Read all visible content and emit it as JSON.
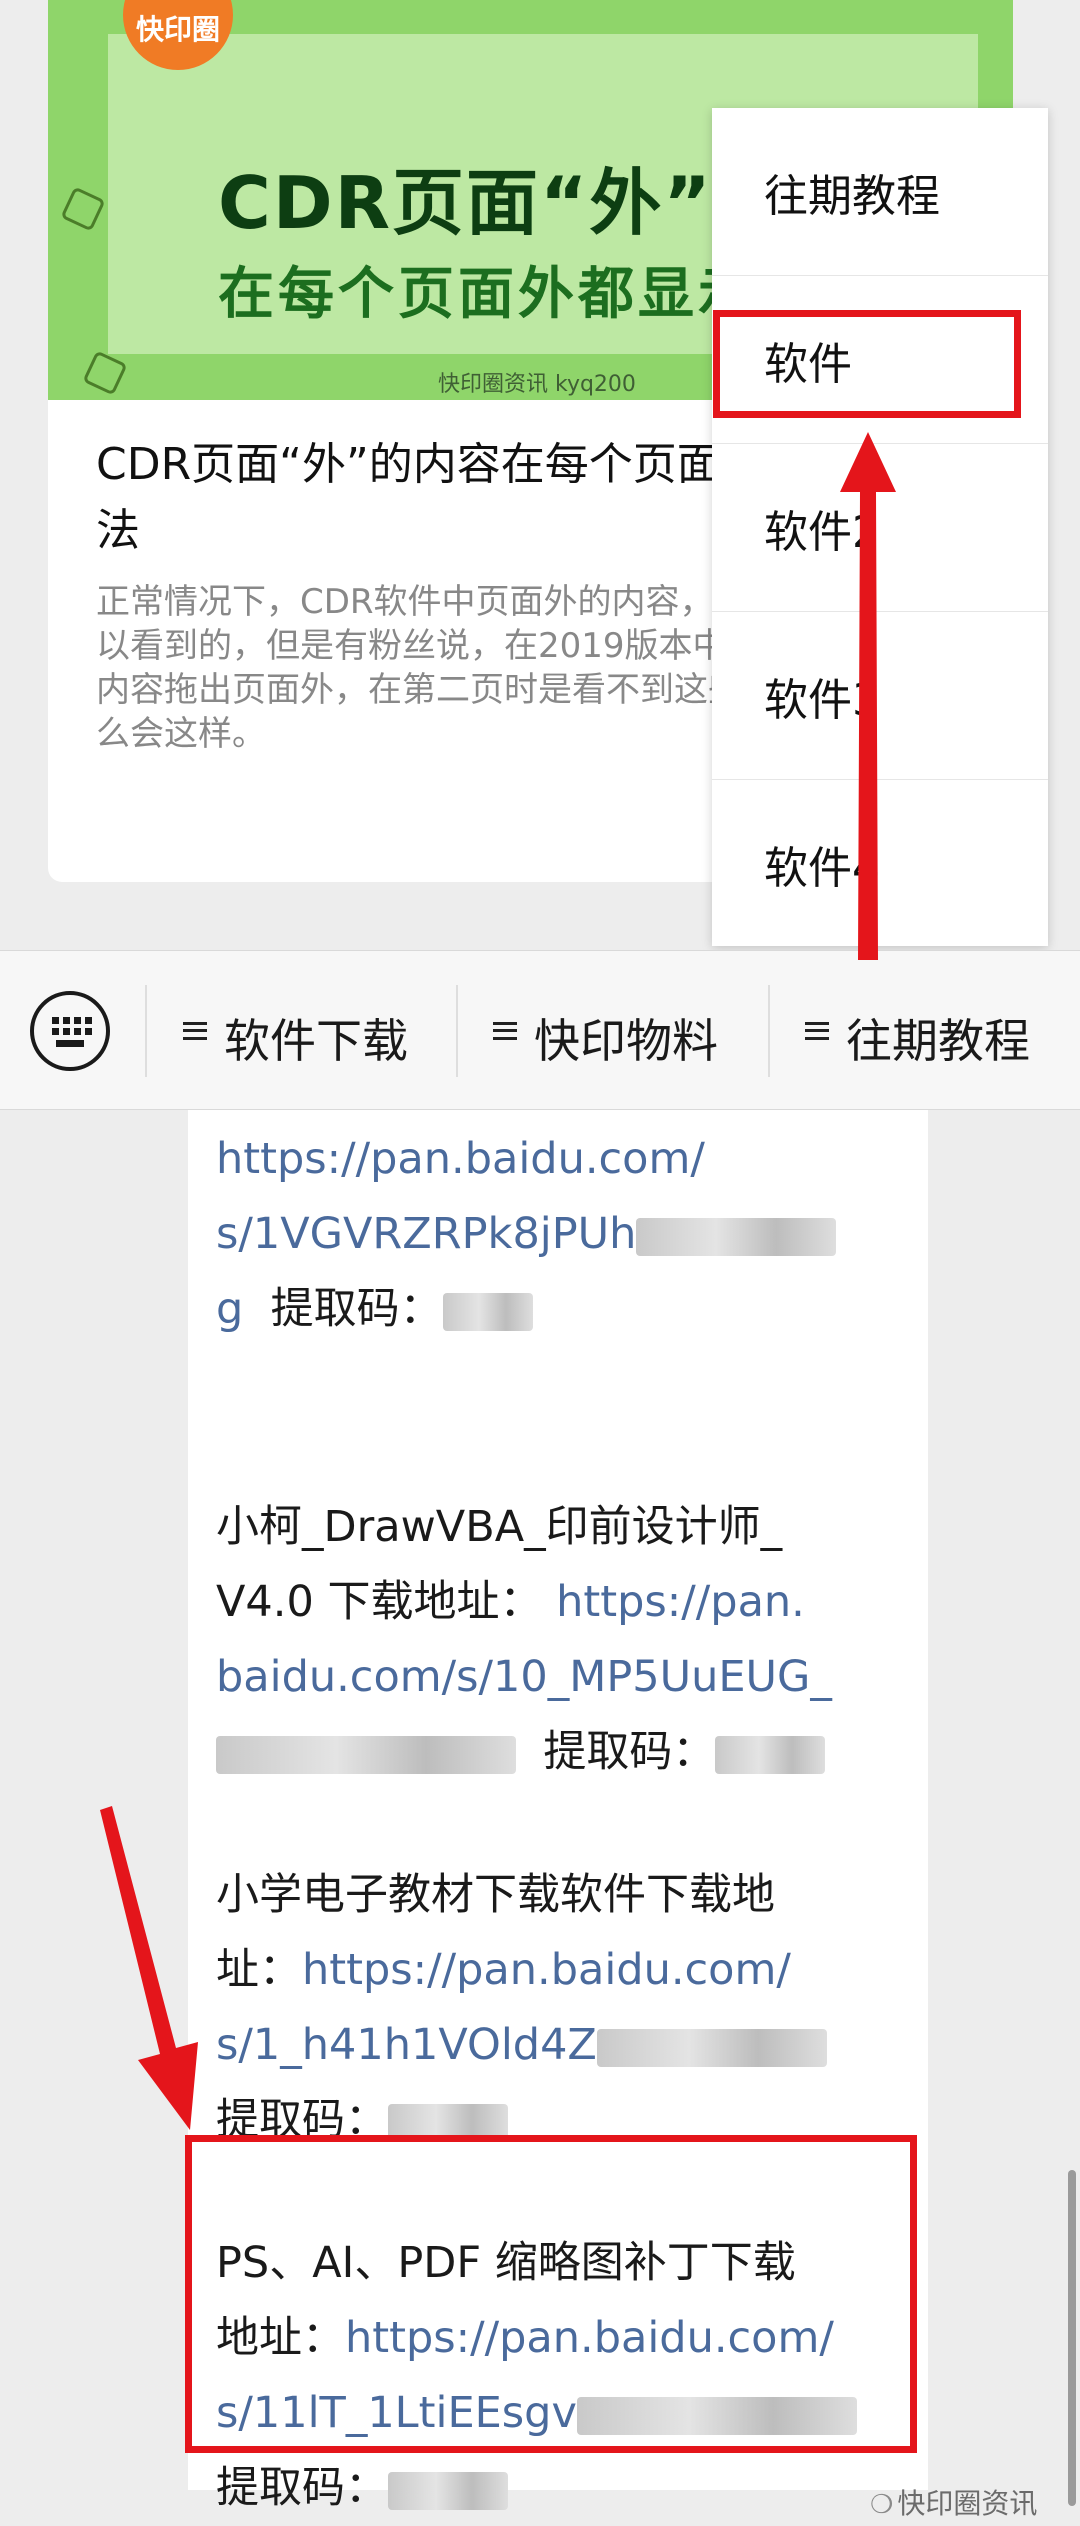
{
  "article": {
    "cover": {
      "logo_text": "快印圈",
      "headline_line1": "CDR页面“外”的",
      "headline_line2": "在每个页面外都显示",
      "credit": "快印圈资讯  kyq200"
    },
    "title": "CDR页面“外”的内容在每个页面都显示的方法",
    "description": "正常情况下，CDR软件中页面外的内容，是在哪个页面可以看到的，但是有粉丝说，在2019版本中，将第一页的内容拖出页面外，在第二页时是看不到这些内容的，为什么会这样。"
  },
  "menu": {
    "items": [
      {
        "label": "往期教程"
      },
      {
        "label": "软件"
      },
      {
        "label": "软件2"
      },
      {
        "label": "软件3"
      },
      {
        "label": "软件4"
      }
    ]
  },
  "navbar": {
    "keyboard_icon": "keyboard-icon",
    "items": [
      {
        "label": "软件下载"
      },
      {
        "label": "快印物料"
      },
      {
        "label": "往期教程"
      }
    ]
  },
  "content": {
    "p1": {
      "link_line1": "https://pan.baidu.com/",
      "link_line2": "s/1VGVRZRPk8jPUh",
      "link_tail": "g",
      "code_label": "提取码："
    },
    "p2": {
      "text_line1": "小柯_DrawVBA_印前设计师_",
      "text_line2": "V4.0 下载地址：",
      "link_a": "https://pan.",
      "link_b": "baidu.com/s/10_MP5UuEUG_",
      "code_label": "提取码："
    },
    "p3": {
      "text_line1": "小学电子教材下载软件下载地",
      "text_line2": "址：",
      "link_a": "https://pan.baidu.com/",
      "link_b": "s/1_h41h1VOld4Z",
      "code_label": "提取码："
    },
    "p4": {
      "text_line1": "PS、AI、PDF 缩略图补丁下载",
      "text_line2": "地址：",
      "link_a": "https://pan.baidu.com/",
      "link_b": "s/11lT_1LtiEEsgv",
      "code_label": "提取码："
    }
  },
  "watermark": {
    "text": "快印圈资讯"
  },
  "colors": {
    "annotation_red": "#e4151b",
    "link": "#4a6a9c",
    "cover_green": "#8fd56a"
  }
}
